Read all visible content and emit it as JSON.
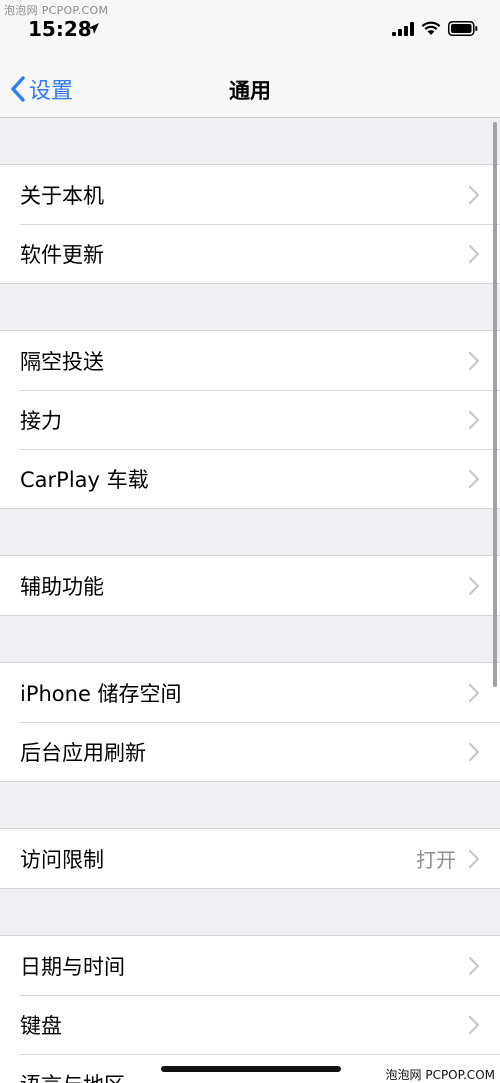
{
  "status_bar": {
    "time": "15:28",
    "watermark": "泡泡网 PCPOP.COM"
  },
  "nav": {
    "back_label": "设置",
    "title": "通用"
  },
  "groups": [
    [
      "关于本机",
      "软件更新"
    ],
    [
      "隔空投送",
      "接力",
      "CarPlay 车载"
    ],
    [
      "辅助功能"
    ],
    [
      "iPhone 储存空间",
      "后台应用刷新"
    ],
    [
      "访问限制"
    ],
    [
      "日期与时间",
      "键盘",
      "语言与地区"
    ]
  ],
  "restrictions_value": "打开",
  "watermark_bottom": "泡泡网 PCPOP.COM",
  "colors": {
    "accent": "#2f7cf6",
    "background": "#efeff4",
    "detail": "#8e8e93"
  }
}
